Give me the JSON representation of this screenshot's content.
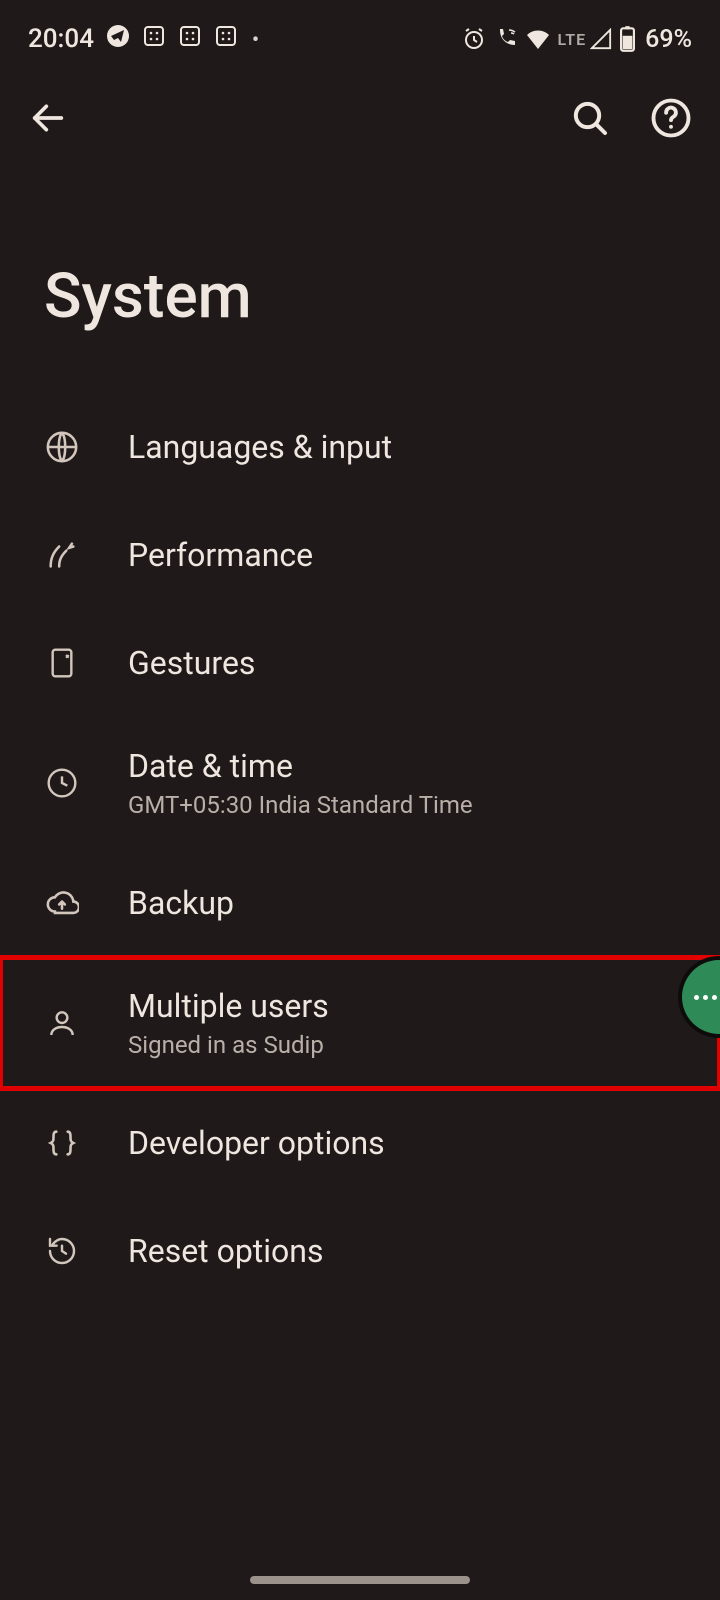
{
  "status_bar": {
    "time": "20:04",
    "lte": "LTE",
    "battery": "69%"
  },
  "page": {
    "title": "System"
  },
  "items": [
    {
      "title": "Languages & input",
      "sub": ""
    },
    {
      "title": "Performance",
      "sub": ""
    },
    {
      "title": "Gestures",
      "sub": ""
    },
    {
      "title": "Date & time",
      "sub": "GMT+05:30 India Standard Time"
    },
    {
      "title": "Backup",
      "sub": ""
    },
    {
      "title": "Multiple users",
      "sub": "Signed in as Sudip"
    },
    {
      "title": "Developer options",
      "sub": ""
    },
    {
      "title": "Reset options",
      "sub": ""
    }
  ]
}
